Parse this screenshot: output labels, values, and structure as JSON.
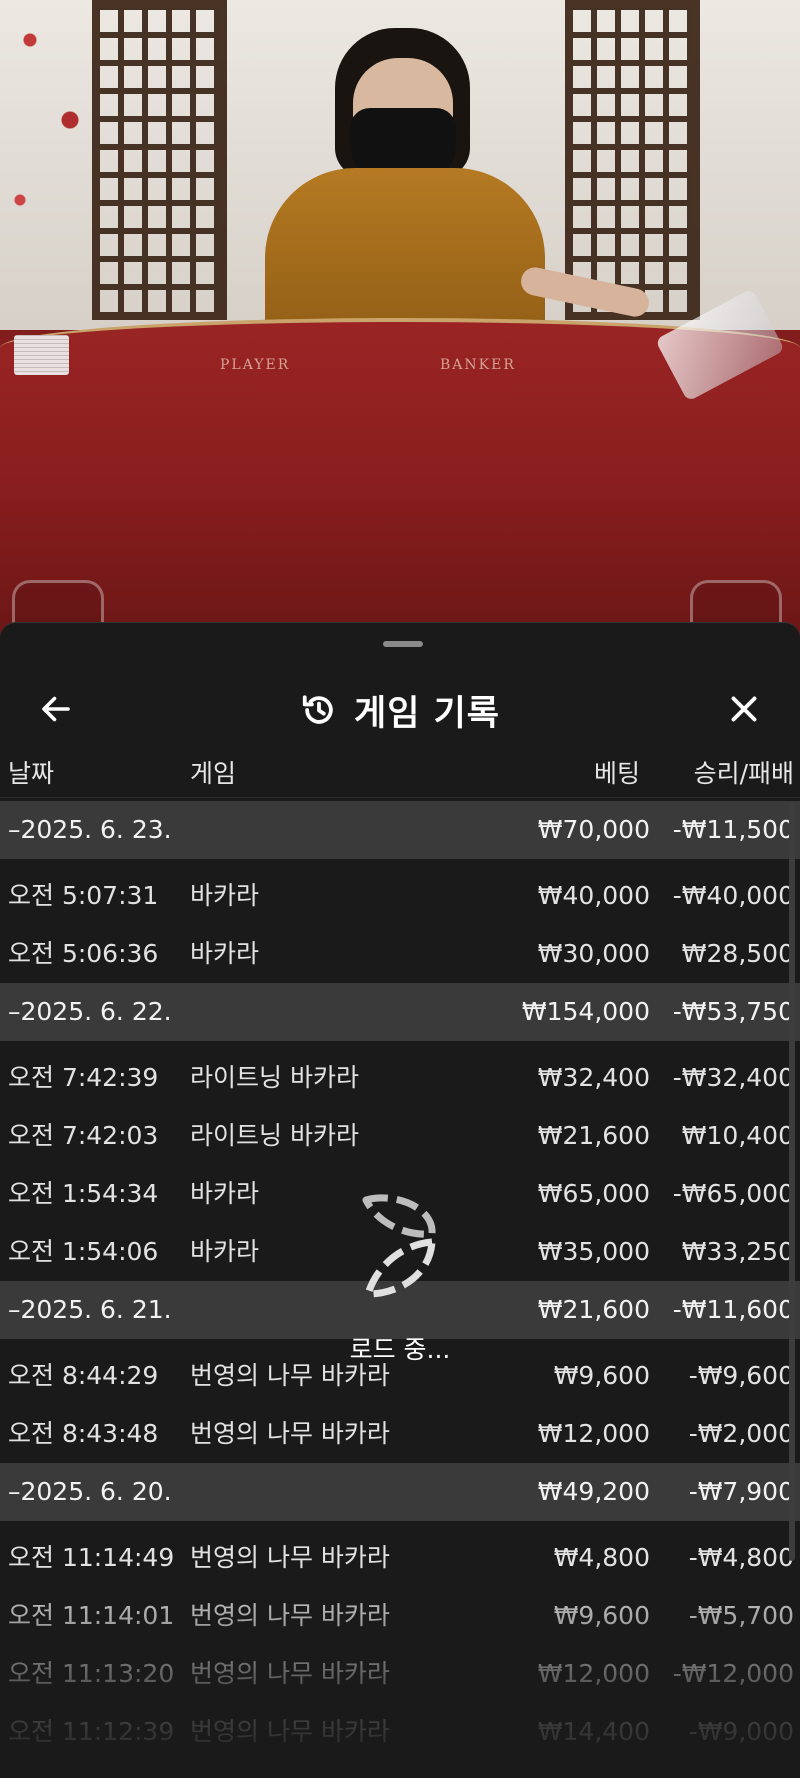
{
  "table": {
    "player_label": "PLAYER",
    "banker_label": "BANKER"
  },
  "sheet": {
    "title": "게임 기록",
    "history_icon": "history-icon",
    "back_icon": "arrow-left-icon",
    "close_icon": "close-icon"
  },
  "columns": {
    "date": "날짜",
    "game": "게임",
    "bet": "베팅",
    "result": "승리/패배"
  },
  "groups": [
    {
      "date": "–2025. 6. 23.",
      "bet": "₩70,000",
      "result": "-₩11,500",
      "items": [
        {
          "time": "오전 5:07:31",
          "game": "바카라",
          "bet": "₩40,000",
          "result": "-₩40,000"
        },
        {
          "time": "오전 5:06:36",
          "game": "바카라",
          "bet": "₩30,000",
          "result": "₩28,500"
        }
      ]
    },
    {
      "date": "–2025. 6. 22.",
      "bet": "₩154,000",
      "result": "-₩53,750",
      "items": [
        {
          "time": "오전 7:42:39",
          "game": "라이트닝 바카라",
          "bet": "₩32,400",
          "result": "-₩32,400"
        },
        {
          "time": "오전 7:42:03",
          "game": "라이트닝 바카라",
          "bet": "₩21,600",
          "result": "₩10,400"
        },
        {
          "time": "오전 1:54:34",
          "game": "바카라",
          "bet": "₩65,000",
          "result": "-₩65,000"
        },
        {
          "time": "오전 1:54:06",
          "game": "바카라",
          "bet": "₩35,000",
          "result": "₩33,250"
        }
      ]
    },
    {
      "date": "–2025. 6. 21.",
      "bet": "₩21,600",
      "result": "-₩11,600",
      "items": [
        {
          "time": "오전 8:44:29",
          "game": "번영의 나무 바카라",
          "bet": "₩9,600",
          "result": "-₩9,600"
        },
        {
          "time": "오전 8:43:48",
          "game": "번영의 나무 바카라",
          "bet": "₩12,000",
          "result": "-₩2,000"
        }
      ]
    },
    {
      "date": "–2025. 6. 20.",
      "bet": "₩49,200",
      "result": "-₩7,900",
      "items": [
        {
          "time": "오전 11:14:49",
          "game": "번영의 나무 바카라",
          "bet": "₩4,800",
          "result": "-₩4,800"
        },
        {
          "time": "오전 11:14:01",
          "game": "번영의 나무 바카라",
          "bet": "₩9,600",
          "result": "-₩5,700"
        },
        {
          "time": "오전 11:13:20",
          "game": "번영의 나무 바카라",
          "bet": "₩12,000",
          "result": "-₩12,000"
        },
        {
          "time": "오전 11:12:39",
          "game": "번영의 나무 바카라",
          "bet": "₩14,400",
          "result": "-₩9,000"
        }
      ]
    }
  ],
  "loading": {
    "text": "로드 중...",
    "icon": "loading-spinner-icon"
  }
}
